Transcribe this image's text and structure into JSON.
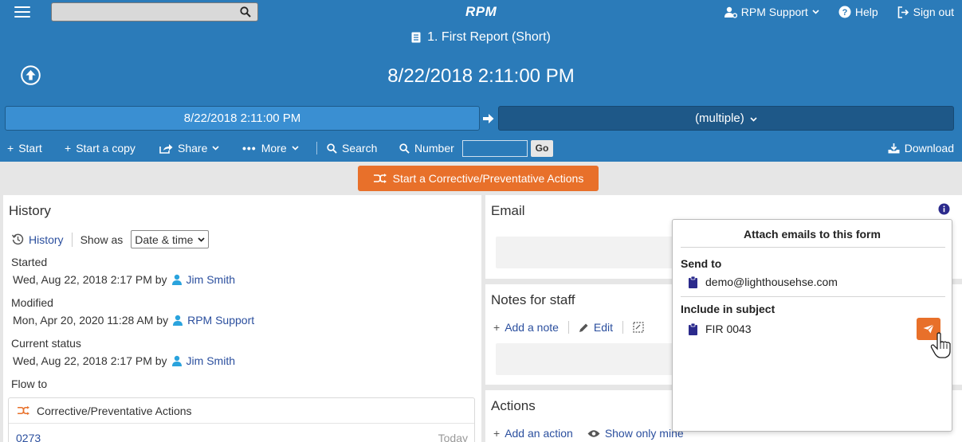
{
  "topbar": {
    "search": {
      "value": "",
      "placeholder": ""
    },
    "logo": "RPM",
    "user_label": "RPM Support",
    "help_label": "Help",
    "signout_label": "Sign out"
  },
  "header": {
    "form_title": "1. First Report (Short)",
    "date_display": "8/22/2018 2:11:00 PM"
  },
  "date_row": {
    "from": "8/22/2018 2:11:00 PM",
    "to": "(multiple)"
  },
  "toolbar": {
    "start": "Start",
    "start_copy": "Start a copy",
    "share": "Share",
    "more": "More",
    "search": "Search",
    "number": "Number",
    "number_value": "",
    "go": "Go",
    "download": "Download"
  },
  "cpa_button": "Start a Corrective/Preventative Actions",
  "history": {
    "title": "History",
    "tab_history": "History",
    "show_as": "Show as",
    "show_as_value": "Date & time",
    "started_label": "Started",
    "started_value": "Wed, Aug 22, 2018 2:17 PM by",
    "started_user": "Jim Smith",
    "modified_label": "Modified",
    "modified_value": "Mon, Apr 20, 2020 11:28 AM by",
    "modified_user": "RPM Support",
    "status_label": "Current status",
    "status_value": "Wed, Aug 22, 2018 2:17 PM by",
    "status_user": "Jim Smith",
    "flow_label": "Flow to",
    "flow_card": {
      "title": "Corrective/Preventative Actions",
      "id": "0273",
      "when": "Today"
    }
  },
  "email": {
    "title": "Email"
  },
  "notes": {
    "title": "Notes for staff",
    "add_note": "Add a note",
    "edit": "Edit"
  },
  "actions": {
    "title": "Actions",
    "add_action": "Add an action",
    "show_mine": "Show only mine"
  },
  "popover": {
    "title": "Attach emails to this form",
    "send_to_label": "Send to",
    "send_to_value": "demo@lighthousehse.com",
    "subject_label": "Include in subject",
    "subject_value": "FIR 0043"
  },
  "colors": {
    "primary": "#2b7bb9",
    "primary_dark": "#1e5888",
    "accent": "#e8702a",
    "link": "#2b4f9e",
    "user_icon": "#2aa3dd",
    "clipboard": "#2b2a8c"
  }
}
